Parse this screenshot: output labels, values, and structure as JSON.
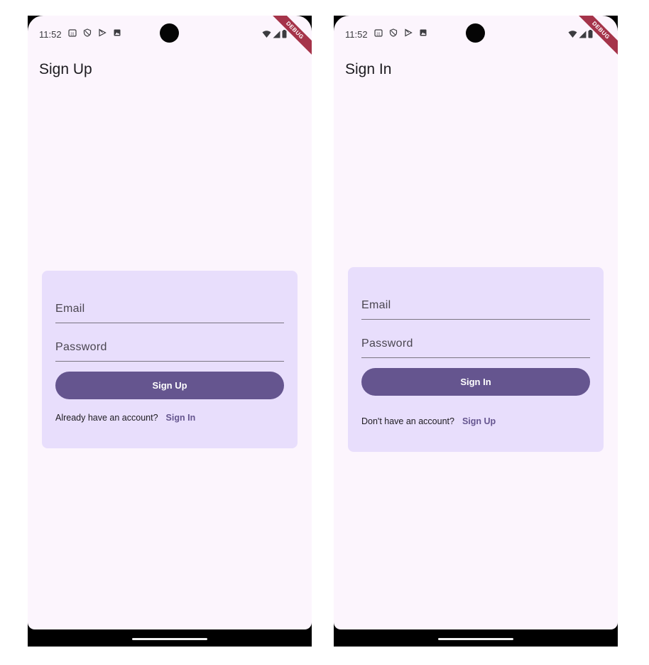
{
  "colors": {
    "background": "#fcf5fd",
    "card": "#e8defc",
    "primary": "#65558f",
    "debug_banner": "#a5344a"
  },
  "screens": [
    {
      "status_bar": {
        "time": "11:52",
        "icons": [
          "calendar-icon",
          "shield-icon",
          "play-store-icon",
          "photo-icon"
        ],
        "right_icons": [
          "wifi-icon",
          "signal-icon",
          "battery-icon"
        ],
        "debug_label": "DEBUG"
      },
      "title": "Sign Up",
      "form": {
        "email_label": "Email",
        "password_label": "Password",
        "button_label": "Sign Up",
        "switch_text": "Already have an account?",
        "switch_link": "Sign In"
      }
    },
    {
      "status_bar": {
        "time": "11:52",
        "icons": [
          "calendar-icon",
          "shield-icon",
          "play-store-icon",
          "photo-icon"
        ],
        "right_icons": [
          "wifi-icon",
          "signal-icon",
          "battery-icon"
        ],
        "debug_label": "DEBUG"
      },
      "title": "Sign In",
      "form": {
        "email_label": "Email",
        "password_label": "Password",
        "button_label": "Sign In",
        "switch_text": "Don't have an account?",
        "switch_link": "Sign Up"
      }
    }
  ]
}
